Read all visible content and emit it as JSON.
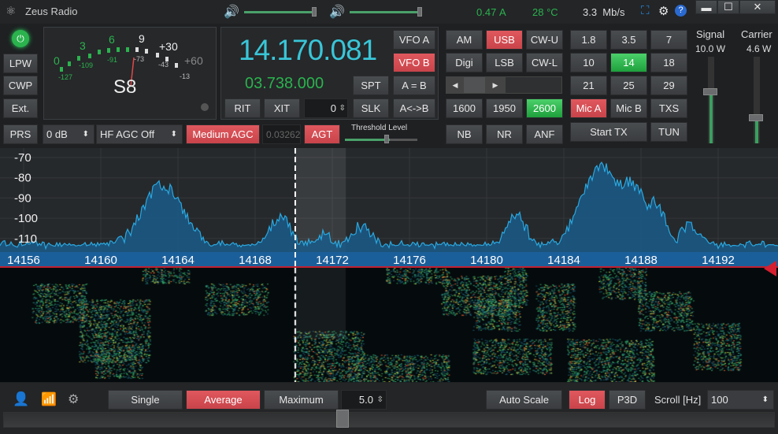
{
  "title_bar": {
    "app_title": "Zeus Radio",
    "current": "0.47",
    "current_unit": "A",
    "temp": "28",
    "temp_unit": "°C",
    "rate": "3.3  Mb/s",
    "volume1": 0.96,
    "volume2": 0.96
  },
  "left": {
    "power": "power",
    "lpw": "LPW",
    "cwp": "CWP",
    "ext": "Ext.",
    "prs": "PRS"
  },
  "meter": {
    "reading": "S8",
    "s_labels": [
      "0",
      "3",
      "6",
      "9",
      "+30",
      "+60"
    ],
    "dbm_labels": [
      "-127",
      "-109",
      "-91",
      "-73",
      "-43",
      "-13"
    ]
  },
  "vfo": {
    "main_freq": "14.170.081",
    "sub_freq": "03.738.000",
    "vfo_a": "VFO A",
    "vfo_b": "VFO B",
    "spt": "SPT",
    "a_eq_b": "A = B",
    "rit": "RIT",
    "xit": "XIT",
    "offset": "0",
    "slk": "SLK",
    "swap": "A<->B"
  },
  "agc": {
    "preamp": "0 dB",
    "hf_agc": "HF AGC Off",
    "agc_mode": "Medium AGC",
    "agc_value": "0.03262",
    "agt": "AGT",
    "threshold_label": "Threshold Level",
    "threshold": 0.62
  },
  "modes": [
    "AM",
    "USB",
    "CW-U",
    "Digi",
    "LSB",
    "CW-L"
  ],
  "filters": [
    "1600",
    "1950",
    "2600"
  ],
  "dsp": [
    "NB",
    "NR",
    "ANF"
  ],
  "bands": [
    "1.8",
    "3.5",
    "7",
    "10",
    "14",
    "18",
    "21",
    "25",
    "29"
  ],
  "tx": {
    "mic_a": "Mic A",
    "mic_b": "Mic B",
    "txs": "TXS",
    "start_tx": "Start TX",
    "tun": "TUN"
  },
  "power": {
    "signal_label": "Signal",
    "signal_value": "10.0 W",
    "signal_level": 0.6,
    "carrier_label": "Carrier",
    "carrier_value": "4.6 W",
    "carrier_level": 0.3
  },
  "spectrum": {
    "y_ticks": [
      "-70",
      "-80",
      "-90",
      "-100",
      "-110"
    ],
    "x_ticks": [
      "14156",
      "14160",
      "14164",
      "14168",
      "14172",
      "14176",
      "14180",
      "14184",
      "14188",
      "14192"
    ],
    "cursor_khz": 14170.08,
    "passband_khz": [
      14170.08,
      14172.7
    ],
    "peaks": [
      [
        14163.2,
        -84
      ],
      [
        14164.4,
        -101
      ],
      [
        14169.3,
        -99
      ],
      [
        14171.5,
        -108
      ],
      [
        14173.5,
        -104
      ],
      [
        14181.5,
        -98
      ],
      [
        14186,
        -74
      ],
      [
        14187.3,
        -82
      ],
      [
        14188.7,
        -92
      ],
      [
        14190.5,
        -104
      ]
    ],
    "colors": {
      "trace": "#2aa8e0",
      "fill": "#1a5a8a"
    }
  },
  "bottom": {
    "single": "Single",
    "average": "Average",
    "maximum": "Maximum",
    "avg_value": "5.0",
    "auto_scale": "Auto Scale",
    "log": "Log",
    "p3d": "P3D",
    "scroll_label": "Scroll [Hz]",
    "scroll_value": "100",
    "zoom": 0.44
  },
  "colors": {
    "red": "#d44c52",
    "green": "#2bb34e",
    "accent": "#39c6d8"
  }
}
